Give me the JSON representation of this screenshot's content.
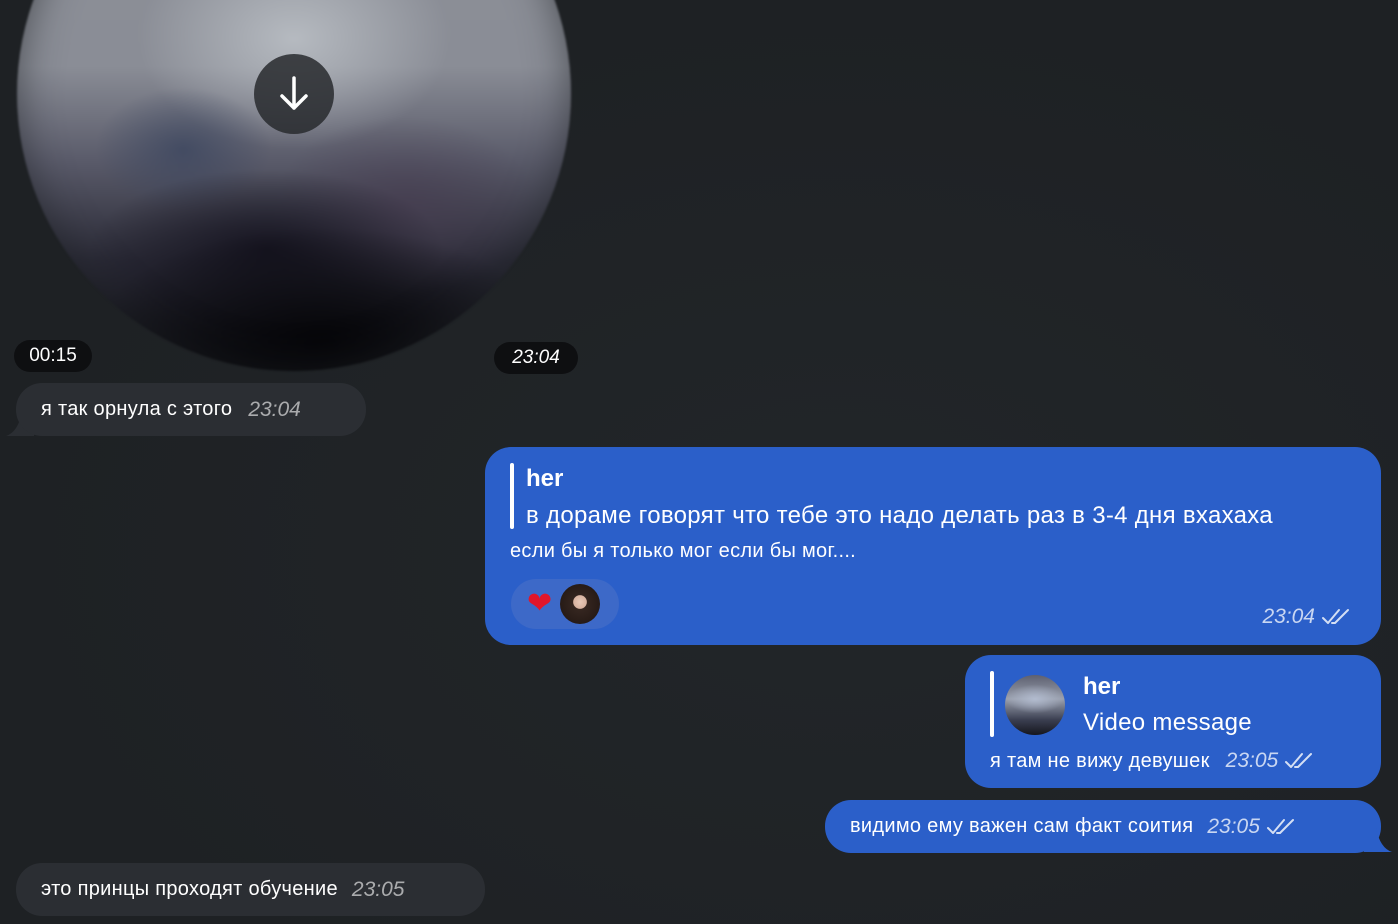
{
  "video_message": {
    "duration": "00:15",
    "time": "23:04",
    "download_icon": "arrow-down-icon"
  },
  "messages": [
    {
      "direction": "in",
      "text": "я так орнула с этого",
      "time": "23:04"
    },
    {
      "direction": "out",
      "reply": {
        "name": "her",
        "text": "в дораме говорят что тебе это надо делать раз в 3-4 дня вхахаха"
      },
      "text": "если бы я только мог если бы мог....",
      "reactions": [
        {
          "icon": "heart-icon",
          "emoji": "❤"
        }
      ],
      "time": "23:04",
      "status": "read"
    },
    {
      "direction": "out",
      "reply": {
        "name": "her",
        "text": "Video message"
      },
      "text": "я там не вижу девушек",
      "time": "23:05",
      "status": "read"
    },
    {
      "direction": "out",
      "text": "видимо ему важен сам факт соития",
      "time": "23:05",
      "status": "read"
    },
    {
      "direction": "in",
      "text": "это принцы проходят обучение",
      "time": "23:05"
    }
  ],
  "colors": {
    "background": "#1f2225",
    "incoming_bubble": "#2b2e33",
    "outgoing_bubble": "#2b5fc9",
    "heart": "#e0162b"
  }
}
